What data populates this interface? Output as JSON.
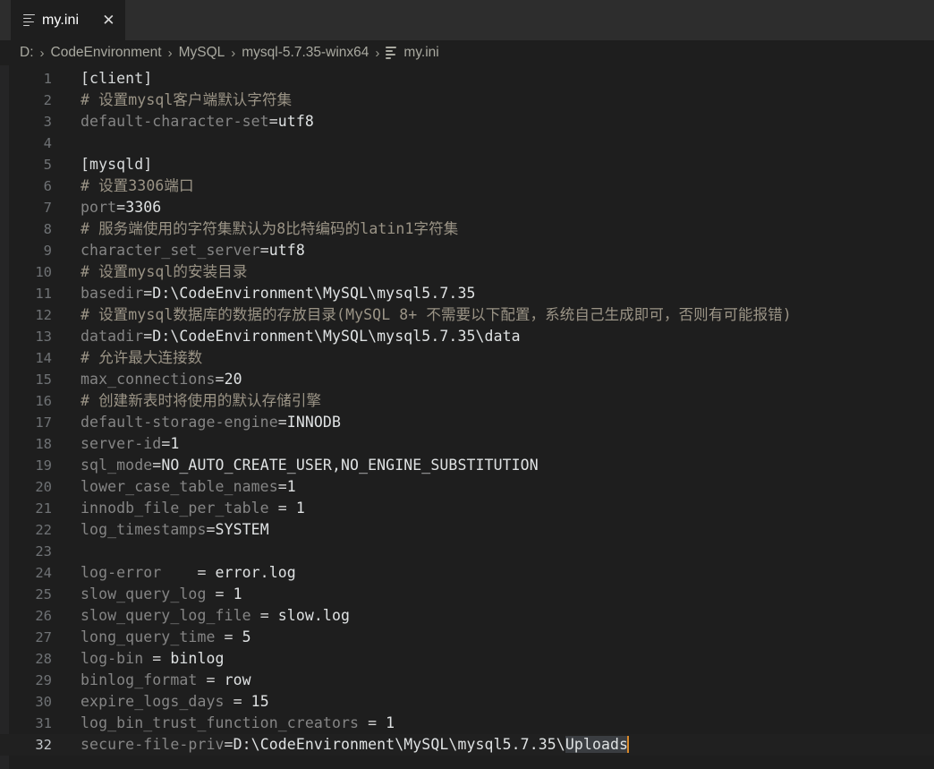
{
  "window": {
    "background": "#1e1e1e",
    "tabbar_background": "#252526",
    "caret_color": "#d8892a",
    "selection_color": "#3a3d41"
  },
  "tabbar": {
    "tabs": [
      {
        "icon": "file-lines-icon",
        "label": "my.ini",
        "close_label": "✕",
        "active": true
      }
    ]
  },
  "breadcrumb": {
    "separator": "›",
    "items": [
      {
        "label": "D:"
      },
      {
        "label": "CodeEnvironment"
      },
      {
        "label": "MySQL"
      },
      {
        "label": "mysql-5.7.35-winx64"
      }
    ],
    "file": {
      "icon": "file-lines-icon",
      "label": "my.ini"
    }
  },
  "editor": {
    "language": "ini",
    "cursor_line": 32,
    "selected_text": "Uploads",
    "lines": [
      {
        "n": 1,
        "type": "section",
        "text": "[client]"
      },
      {
        "n": 2,
        "type": "comment",
        "text": "# 设置mysql客户端默认字符集"
      },
      {
        "n": 3,
        "type": "pair",
        "key": "default-character-set",
        "op": "=",
        "value": "utf8"
      },
      {
        "n": 4,
        "type": "blank",
        "text": ""
      },
      {
        "n": 5,
        "type": "section",
        "text": "[mysqld]"
      },
      {
        "n": 6,
        "type": "comment",
        "text": "# 设置3306端口"
      },
      {
        "n": 7,
        "type": "pair",
        "key": "port",
        "op": "=",
        "value": "3306"
      },
      {
        "n": 8,
        "type": "comment",
        "text": "# 服务端使用的字符集默认为8比特编码的latin1字符集"
      },
      {
        "n": 9,
        "type": "pair",
        "key": "character_set_server",
        "op": "=",
        "value": "utf8"
      },
      {
        "n": 10,
        "type": "comment",
        "text": "# 设置mysql的安装目录"
      },
      {
        "n": 11,
        "type": "pair",
        "key": "basedir",
        "op": "=",
        "value": "D:\\CodeEnvironment\\MySQL\\mysql5.7.35"
      },
      {
        "n": 12,
        "type": "comment",
        "text": "# 设置mysql数据库的数据的存放目录(MySQL 8+ 不需要以下配置，系统自己生成即可，否则有可能报错)"
      },
      {
        "n": 13,
        "type": "pair",
        "key": "datadir",
        "op": "=",
        "value": "D:\\CodeEnvironment\\MySQL\\mysql5.7.35\\data"
      },
      {
        "n": 14,
        "type": "comment",
        "text": "# 允许最大连接数"
      },
      {
        "n": 15,
        "type": "pair",
        "key": "max_connections",
        "op": "=",
        "value": "20"
      },
      {
        "n": 16,
        "type": "comment",
        "text": "# 创建新表时将使用的默认存储引擎"
      },
      {
        "n": 17,
        "type": "pair",
        "key": "default-storage-engine",
        "op": "=",
        "value": "INNODB"
      },
      {
        "n": 18,
        "type": "pair",
        "key": "server-id",
        "op": "=",
        "value": "1"
      },
      {
        "n": 19,
        "type": "pair",
        "key": "sql_mode",
        "op": "=",
        "value": "NO_AUTO_CREATE_USER,NO_ENGINE_SUBSTITUTION"
      },
      {
        "n": 20,
        "type": "pair",
        "key": "lower_case_table_names",
        "op": "=",
        "value": "1"
      },
      {
        "n": 21,
        "type": "pair",
        "key": "innodb_file_per_table",
        "op": " = ",
        "value": "1"
      },
      {
        "n": 22,
        "type": "pair",
        "key": "log_timestamps",
        "op": "=",
        "value": "SYSTEM"
      },
      {
        "n": 23,
        "type": "blank",
        "text": ""
      },
      {
        "n": 24,
        "type": "pair",
        "key": "log-error",
        "op": "    = ",
        "value": "error.log"
      },
      {
        "n": 25,
        "type": "pair",
        "key": "slow_query_log",
        "op": " = ",
        "value": "1"
      },
      {
        "n": 26,
        "type": "pair",
        "key": "slow_query_log_file",
        "op": " = ",
        "value": "slow.log"
      },
      {
        "n": 27,
        "type": "pair",
        "key": "long_query_time",
        "op": " = ",
        "value": "5"
      },
      {
        "n": 28,
        "type": "pair",
        "key": "log-bin",
        "op": " = ",
        "value": "binlog"
      },
      {
        "n": 29,
        "type": "pair",
        "key": "binlog_format",
        "op": " = ",
        "value": "row"
      },
      {
        "n": 30,
        "type": "pair",
        "key": "expire_logs_days",
        "op": " = ",
        "value": "15"
      },
      {
        "n": 31,
        "type": "pair",
        "key": "log_bin_trust_function_creators",
        "op": " = ",
        "value": "1"
      },
      {
        "n": 32,
        "type": "pair",
        "key": "secure-file-priv",
        "op": "=",
        "value": "D:\\CodeEnvironment\\MySQL\\mysql5.7.35\\",
        "value_selected": "Uploads",
        "current": true
      }
    ]
  }
}
